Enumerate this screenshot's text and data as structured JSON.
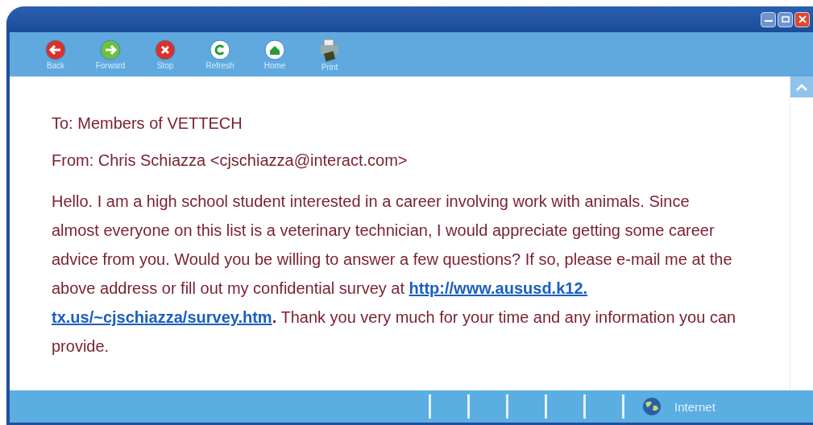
{
  "toolbar": [
    {
      "label": "Back",
      "kind": "back"
    },
    {
      "label": "Forward",
      "kind": "forward"
    },
    {
      "label": "Stop",
      "kind": "stop"
    },
    {
      "label": "Refresh",
      "kind": "refresh"
    },
    {
      "label": "Home",
      "kind": "home"
    },
    {
      "label": "Print",
      "kind": "print"
    }
  ],
  "message": {
    "to": "To: Members of VETTECH",
    "from": "From: Chris Schiazza <cjschiazza@interact.com>",
    "body_before": "Hello. I am a high school student interested in a career involving work with animals. Since almost everyone on this list is a veterinary technician, I would appreciate getting some career advice from you. Would you be willing to answer a few questions? If so, please e-mail me at the above address or fill out my confidential survey at",
    "link": [
      "http://www.aususd.k12.",
      "tx.us/~cjschiazza/survey.htm"
    ],
    "body_after": "**.** Thank you very much for your time and any information you can provide."
  },
  "status_bar": {
    "zone": "Internet"
  }
}
